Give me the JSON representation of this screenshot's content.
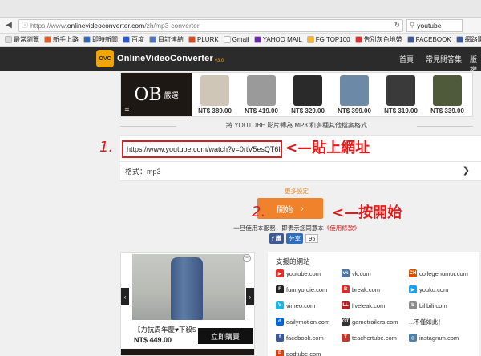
{
  "browser": {
    "url_prefix": "https://www.",
    "url_host": "onlinevideoconverter.com",
    "url_path": "/zh/mp3-converter",
    "search_value": "youtube"
  },
  "bookmarks": [
    {
      "label": "最常瀏覽",
      "color": "#d9d9d9"
    },
    {
      "label": "新手上路",
      "color": "#e25c26"
    },
    {
      "label": "即時新聞",
      "color": "#2a6bc1"
    },
    {
      "label": "百度",
      "color": "#2b58d6"
    },
    {
      "label": "目訂連結",
      "color": "#4a78c2"
    },
    {
      "label": "PLURK",
      "color": "#d24b22"
    },
    {
      "label": "Gmail",
      "color": "#ffffff"
    },
    {
      "label": "YAHOO MAIL",
      "color": "#6b2aa5"
    },
    {
      "label": "FG TOP100",
      "color": "#f2b632"
    },
    {
      "label": "告別灰色地帶",
      "color": "#d83131"
    },
    {
      "label": "FACEBOOK",
      "color": "#3b5998"
    },
    {
      "label": "網路影視",
      "color": "#3b5998"
    }
  ],
  "header": {
    "logo_mark": "OVC",
    "logo_text": "OnlineVideoConverter",
    "logo_version": "v3.0",
    "nav": [
      "首頁",
      "常見問答集",
      "版權"
    ]
  },
  "banner": {
    "brand": "OB",
    "brand_sub": "嚴選",
    "eq": "=",
    "products": [
      {
        "price": "NT$ 389.00",
        "color": "#cfc6b8"
      },
      {
        "price": "NT$ 419.00",
        "color": "#9a9a9a"
      },
      {
        "price": "NT$ 329.00",
        "color": "#2a2a2a"
      },
      {
        "price": "NT$ 399.00",
        "color": "#6c8aa6"
      },
      {
        "price": "NT$ 319.00",
        "color": "#3a3a3a"
      },
      {
        "price": "NT$ 339.00",
        "color": "#4f5a3a"
      }
    ]
  },
  "headline": "將 YOUTUBE 影片轉為 MP3 和多種其他檔案格式",
  "converter": {
    "url_value": "https://www.youtube.com/watch?v=0rtV5esQT6I",
    "format_label": "格式：",
    "format_value": "mp3",
    "more_settings": "更多設定",
    "start_label": "開始",
    "start_arrow": "›",
    "terms_text": "一旦使用本服務，即表示您同意本",
    "terms_link": "《使用條款》"
  },
  "share": {
    "fb_label": "f 讚",
    "share_label": "分享",
    "count": "95"
  },
  "ad": {
    "caption": "【力抗周年慶♥下殺5",
    "price": "NT$ 449.00",
    "buy_label": "立即購買",
    "prev": "‹",
    "next": "›",
    "close": "×"
  },
  "sites": {
    "title": "支援的網站",
    "items": [
      {
        "name": "youtube.com",
        "icon": "youtube-icon",
        "color": "#e52d27",
        "glyph": "▶"
      },
      {
        "name": "vk.com",
        "icon": "vk-icon",
        "color": "#4c75a3",
        "glyph": "vk"
      },
      {
        "name": "collegehumor.com",
        "icon": "collegehumor-icon",
        "color": "#d35400",
        "glyph": "CH"
      },
      {
        "name": "funnyordie.com",
        "icon": "funnyordie-icon",
        "color": "#222222",
        "glyph": "F"
      },
      {
        "name": "break.com",
        "icon": "break-icon",
        "color": "#d0312d",
        "glyph": "B"
      },
      {
        "name": "youku.com",
        "icon": "youku-icon",
        "color": "#1fa0e6",
        "glyph": "▶"
      },
      {
        "name": "vimeo.com",
        "icon": "vimeo-icon",
        "color": "#1ab7ea",
        "glyph": "V"
      },
      {
        "name": "liveleak.com",
        "icon": "liveleak-icon",
        "color": "#b32020",
        "glyph": "LL"
      },
      {
        "name": "bilibili.com",
        "icon": "bilibili-icon",
        "color": "#8c8c8c",
        "glyph": "b"
      },
      {
        "name": "dailymotion.com",
        "icon": "dailymotion-icon",
        "color": "#0066dc",
        "glyph": "d"
      },
      {
        "name": "gametrailers.com",
        "icon": "gametrailers-icon",
        "color": "#333333",
        "glyph": "GT"
      },
      {
        "name": "...不僅如此！",
        "icon": "",
        "color": "",
        "glyph": ""
      },
      {
        "name": "facebook.com",
        "icon": "facebook-icon",
        "color": "#3b5998",
        "glyph": "f"
      },
      {
        "name": "teachertube.com",
        "icon": "teachertube-icon",
        "color": "#c0392b",
        "glyph": "T"
      },
      {
        "name": "instagram.com",
        "icon": "instagram-icon",
        "color": "#517fa4",
        "glyph": "◎"
      },
      {
        "name": "podtube.com",
        "icon": "podtube-icon",
        "color": "#d84315",
        "glyph": "P"
      }
    ]
  },
  "annotations": {
    "n1": "1.",
    "t1": "<—貼上網址",
    "n2": "2.",
    "t2": "<—按開始"
  }
}
